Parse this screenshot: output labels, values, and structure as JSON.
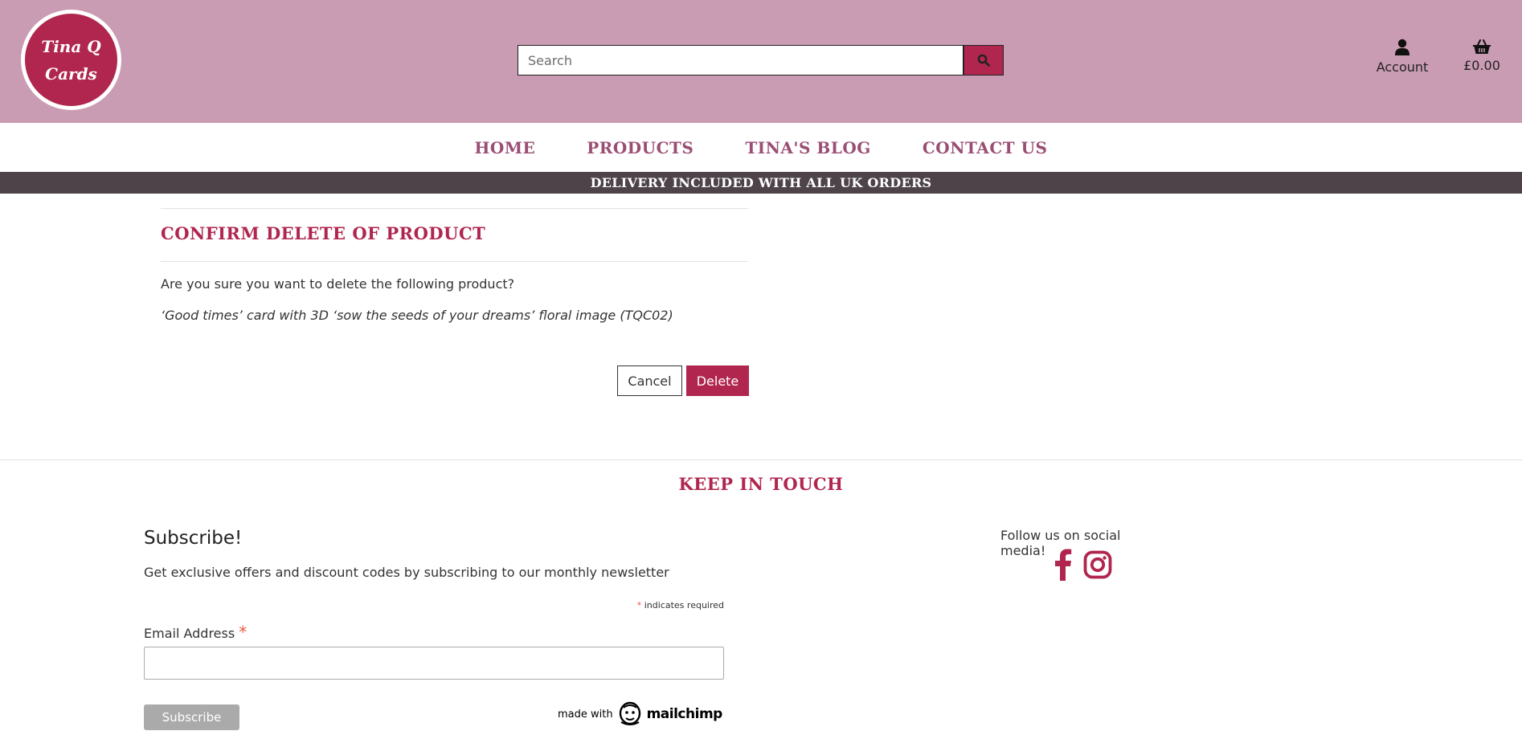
{
  "brand": {
    "logo_line1": "Tina Q",
    "logo_line2": "Cards",
    "accent_color": "#b0264e",
    "header_bg": "#c99cb3",
    "nav_color": "#9a4e74",
    "banner_bg": "#4e4349"
  },
  "header": {
    "search_placeholder": "Search",
    "search_icon": "search-icon",
    "account_label": "Account",
    "account_icon": "user-icon",
    "cart_total": "£0.00",
    "cart_icon": "basket-icon"
  },
  "nav": {
    "items": [
      {
        "label": "HOME"
      },
      {
        "label": "PRODUCTS"
      },
      {
        "label": "TINA'S BLOG"
      },
      {
        "label": "CONTACT US"
      }
    ]
  },
  "banner": {
    "text": "DELIVERY INCLUDED WITH ALL UK ORDERS"
  },
  "main": {
    "title": "CONFIRM DELETE OF PRODUCT",
    "question": "Are you sure you want to delete the following product?",
    "product": "‘Good times’ card with 3D ‘sow the seeds of your dreams’ floral image (TQC02)",
    "cancel_label": "Cancel",
    "delete_label": "Delete"
  },
  "footer": {
    "heading": "KEEP IN TOUCH",
    "subscribe_title": "Subscribe!",
    "subscribe_desc": "Get exclusive offers and discount codes by subscribing to our monthly newsletter",
    "required_star": "*",
    "required_note": " indicates required",
    "email_label": "Email Address",
    "email_star": "*",
    "email_value": "",
    "subscribe_button": "Subscribe",
    "mailchimp_made": "made with",
    "mailchimp_word": "mailchimp",
    "follow_text": "Follow us on social media!",
    "social_icons": [
      "facebook-icon",
      "instagram-icon"
    ]
  }
}
